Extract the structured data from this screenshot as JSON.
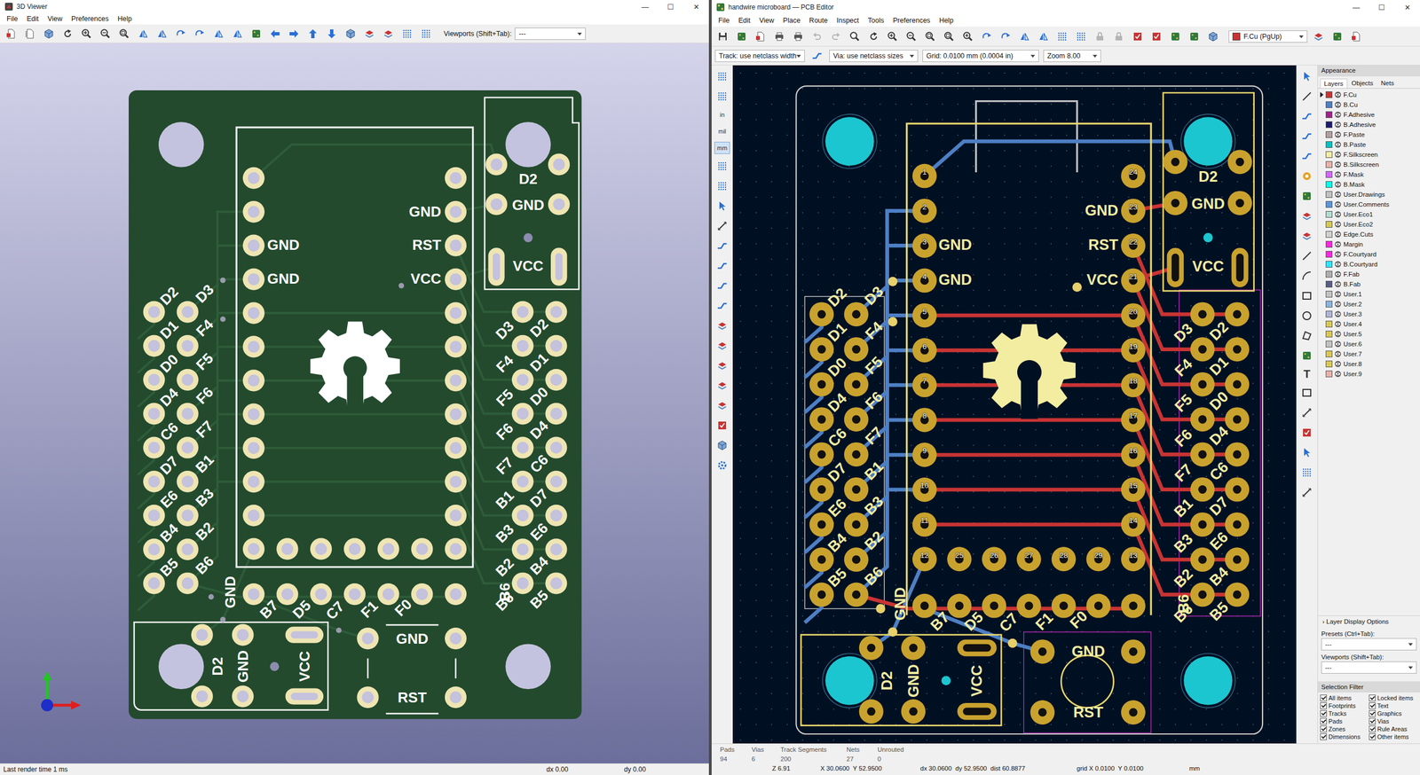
{
  "viewer": {
    "title": "3D Viewer",
    "controls": [
      "—",
      "☐",
      "✕"
    ],
    "menu": [
      "File",
      "Edit",
      "View",
      "Preferences",
      "Help"
    ],
    "viewports": {
      "label": "Viewports (Shift+Tab):",
      "value": "---"
    },
    "status": {
      "message": "Last render time 1 ms",
      "dx": "dx 0.00",
      "dy": "dy 0.00"
    }
  },
  "board": {
    "module_left": [
      "GND",
      "GND"
    ],
    "module_right": [
      "GND",
      "RST",
      "VCC"
    ],
    "header_left_a": [
      "D2",
      "D1",
      "D0",
      "D4",
      "C6",
      "D7",
      "E6",
      "B4",
      "B5"
    ],
    "header_left_b": [
      "D3",
      "F4",
      "F5",
      "F6",
      "F7",
      "B1",
      "B3",
      "B2",
      "B6"
    ],
    "header_right_a": [
      "D3",
      "F4",
      "F5",
      "F6",
      "F7",
      "B1",
      "B3",
      "B2",
      "B6"
    ],
    "header_right_b": [
      "D2",
      "D1",
      "D0",
      "D4",
      "C6",
      "D7",
      "E6",
      "B4",
      "B5"
    ],
    "bottom": [
      "GND",
      "B7",
      "D5",
      "C7",
      "F1",
      "F0",
      "B6"
    ],
    "connector_top": [
      "D2",
      "GND",
      "VCC"
    ],
    "connector_bottom": [
      "D2",
      "GND",
      "VCC"
    ],
    "button": [
      "GND",
      "RST"
    ]
  },
  "pcb": {
    "title": "handwire microboard — PCB Editor",
    "controls": [
      "—",
      "☐",
      "✕"
    ],
    "menu": [
      "File",
      "Edit",
      "View",
      "Place",
      "Route",
      "Inspect",
      "Tools",
      "Preferences",
      "Help"
    ],
    "layer_select": "F.Cu (PgUp)",
    "track": "Track: use netclass width",
    "via": "Via: use netclass sizes",
    "grid": "Grid: 0.0100 mm (0.0004 in)",
    "zoom": "Zoom 8.00",
    "units": [
      {
        "label": "in",
        "selected": false
      },
      {
        "label": "mil",
        "selected": false
      },
      {
        "label": "mm",
        "selected": true
      }
    ],
    "text_tool": "T",
    "pad_numbers": {
      "left": [
        "1",
        "2",
        "3",
        "4",
        "5",
        "6",
        "7",
        "8",
        "9",
        "10",
        "11"
      ],
      "right": [
        "24",
        "23",
        "22",
        "21",
        "20",
        "19",
        "18",
        "17",
        "16",
        "15",
        "14"
      ],
      "bottom": [
        "12",
        "25",
        "26",
        "27",
        "28",
        "29",
        "13"
      ]
    },
    "appearance": {
      "title": "Appearance",
      "tabs": [
        {
          "label": "Layers",
          "selected": true
        },
        {
          "label": "Objects",
          "selected": false
        },
        {
          "label": "Nets",
          "selected": false
        }
      ],
      "layers": [
        {
          "name": "F.Cu",
          "color": "#c83434",
          "selected": true,
          "visible": true
        },
        {
          "name": "B.Cu",
          "color": "#4d7fc4",
          "selected": false,
          "visible": true
        },
        {
          "name": "F.Adhesive",
          "color": "#a0208c",
          "selected": false,
          "visible": true
        },
        {
          "name": "B.Adhesive",
          "color": "#1a1a72",
          "selected": false,
          "visible": true
        },
        {
          "name": "F.Paste",
          "color": "#b49e9e",
          "selected": false,
          "visible": true
        },
        {
          "name": "B.Paste",
          "color": "#00c2c2",
          "selected": false,
          "visible": true
        },
        {
          "name": "F.Silkscreen",
          "color": "#f2eda1",
          "selected": false,
          "visible": true
        },
        {
          "name": "B.Silkscreen",
          "color": "#e8b2a7",
          "selected": false,
          "visible": true
        },
        {
          "name": "F.Mask",
          "color": "#d864ff",
          "selected": false,
          "visible": true
        },
        {
          "name": "B.Mask",
          "color": "#02ffee",
          "selected": false,
          "visible": true
        },
        {
          "name": "User.Drawings",
          "color": "#c2c2c2",
          "selected": false,
          "visible": true
        },
        {
          "name": "User.Comments",
          "color": "#5994dc",
          "selected": false,
          "visible": true
        },
        {
          "name": "User.Eco1",
          "color": "#b4dbd2",
          "selected": false,
          "visible": true
        },
        {
          "name": "User.Eco2",
          "color": "#d8c852",
          "selected": false,
          "visible": true
        },
        {
          "name": "Edge.Cuts",
          "color": "#d0d2cd",
          "selected": false,
          "visible": true
        },
        {
          "name": "Margin",
          "color": "#ff26e2",
          "selected": false,
          "visible": true
        },
        {
          "name": "F.Courtyard",
          "color": "#ff26e2",
          "selected": false,
          "visible": true
        },
        {
          "name": "B.Courtyard",
          "color": "#26e9ff",
          "selected": false,
          "visible": true
        },
        {
          "name": "F.Fab",
          "color": "#afafaf",
          "selected": false,
          "visible": true
        },
        {
          "name": "B.Fab",
          "color": "#585d84",
          "selected": false,
          "visible": true
        },
        {
          "name": "User.1",
          "color": "#c2c2c2",
          "selected": false,
          "visible": true
        },
        {
          "name": "User.2",
          "color": "#89b4e1",
          "selected": false,
          "visible": true
        },
        {
          "name": "User.3",
          "color": "#b0b4d6",
          "selected": false,
          "visible": true
        },
        {
          "name": "User.4",
          "color": "#d8c852",
          "selected": false,
          "visible": true
        },
        {
          "name": "User.5",
          "color": "#d8c852",
          "selected": false,
          "visible": true
        },
        {
          "name": "User.6",
          "color": "#c2c2c2",
          "selected": false,
          "visible": true
        },
        {
          "name": "User.7",
          "color": "#d8c852",
          "selected": false,
          "visible": true
        },
        {
          "name": "User.8",
          "color": "#d8c852",
          "selected": false,
          "visible": true
        },
        {
          "name": "User.9",
          "color": "#e8b2a7",
          "selected": false,
          "visible": true
        }
      ],
      "display_options": {
        "arrow": "›",
        "label": "Layer Display Options"
      },
      "presets": {
        "label": "Presets (Ctrl+Tab):",
        "value": "---"
      },
      "viewports": {
        "label": "Viewports (Shift+Tab):",
        "value": "---"
      },
      "selection_filter": {
        "title": "Selection Filter",
        "items": [
          {
            "label": "All items",
            "checked": true
          },
          {
            "label": "Locked items",
            "checked": true
          },
          {
            "label": "Footprints",
            "checked": true
          },
          {
            "label": "Text",
            "checked": true
          },
          {
            "label": "Tracks",
            "checked": true
          },
          {
            "label": "Graphics",
            "checked": true
          },
          {
            "label": "Pads",
            "checked": true
          },
          {
            "label": "Vias",
            "checked": true
          },
          {
            "label": "Zones",
            "checked": true
          },
          {
            "label": "Rule Areas",
            "checked": true
          },
          {
            "label": "Dimensions",
            "checked": true
          },
          {
            "label": "Other items",
            "checked": true
          }
        ]
      }
    },
    "stats": [
      {
        "label": "Pads",
        "value": "94"
      },
      {
        "label": "Vias",
        "value": "6"
      },
      {
        "label": "Track Segments",
        "value": "200"
      },
      {
        "label": "Nets",
        "value": "27"
      },
      {
        "label": "Unrouted",
        "value": "0"
      }
    ],
    "coords": [
      "Z 6.91",
      "X 30.0600  Y 52.9500",
      "dx 30.0600  dy 52.9500  dist 60.8877",
      "grid X 0.0100  Y 0.0100",
      "mm"
    ]
  }
}
